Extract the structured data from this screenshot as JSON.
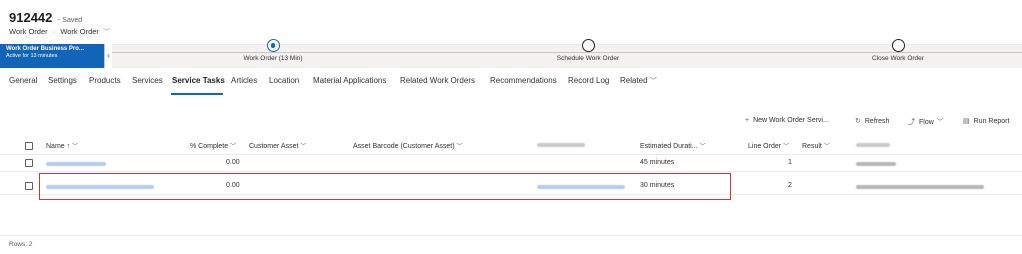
{
  "record": {
    "title": "912442",
    "saved_status": "- Saved",
    "entity": "Work Order",
    "form": "Work Order"
  },
  "bpf": {
    "active_process": "Work Order Business Pro...",
    "active_duration": "Active for 13 minutes",
    "stages": [
      {
        "label": "Work Order  (13 Min)",
        "state": "active"
      },
      {
        "label": "Schedule Work Order",
        "state": "pending"
      },
      {
        "label": "Close Work Order",
        "state": "pending"
      }
    ]
  },
  "tabs": [
    {
      "label": "General"
    },
    {
      "label": "Settings"
    },
    {
      "label": "Products"
    },
    {
      "label": "Services"
    },
    {
      "label": "Service Tasks",
      "active": true
    },
    {
      "label": "Articles"
    },
    {
      "label": "Location"
    },
    {
      "label": "Material Applications"
    },
    {
      "label": "Related Work Orders"
    },
    {
      "label": "Recommendations"
    },
    {
      "label": "Record Log"
    },
    {
      "label": "Related"
    }
  ],
  "commands": {
    "new_label": "New Work Order Servi...",
    "refresh_label": "Refresh",
    "flow_label": "Flow",
    "run_report_label": "Run Report"
  },
  "grid": {
    "columns": {
      "name": "Name ↑",
      "percent_complete": "% Complete",
      "customer_asset": "Customer Asset",
      "asset_barcode": "Asset Barcode (Customer Asset)",
      "estimated_duration": "Estimated Durati...",
      "line_order": "Line Order",
      "result": "Result"
    },
    "rows": [
      {
        "percent_complete": "0.00",
        "estimated_duration": "45 minutes",
        "line_order": "1"
      },
      {
        "percent_complete": "0.00",
        "estimated_duration": "30 minutes",
        "line_order": "2"
      }
    ],
    "rows_count": "Rows: 2"
  },
  "colors": {
    "accent": "#1264b8",
    "highlight": "#d13438"
  }
}
